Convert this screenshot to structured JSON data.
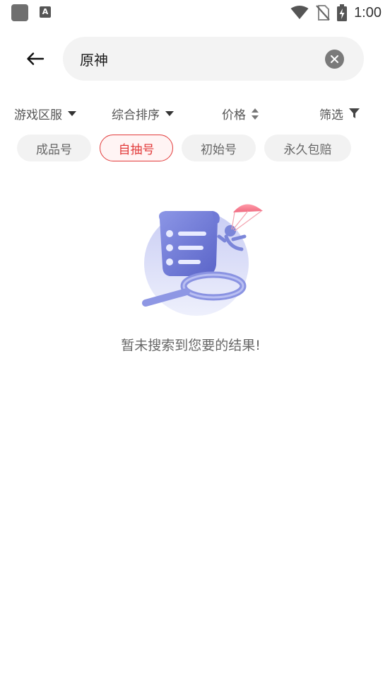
{
  "status_bar": {
    "time": "1:00",
    "left_icons": [
      "app-square-icon",
      "a-text-icon"
    ],
    "right_icons": [
      "wifi-icon",
      "no-sim-icon",
      "battery-charging-icon"
    ]
  },
  "header": {
    "back_icon": "arrow-left-icon",
    "search_value": "原神",
    "clear_icon": "clear-circle-icon"
  },
  "filters": [
    {
      "label": "游戏区服",
      "icon": "caret-down-icon"
    },
    {
      "label": "综合排序",
      "icon": "caret-down-icon"
    },
    {
      "label": "价格",
      "icon": "sort-updown-icon"
    },
    {
      "label": "筛选",
      "icon": "funnel-icon"
    }
  ],
  "chips": [
    {
      "label": "成品号",
      "active": false
    },
    {
      "label": "自抽号",
      "active": true
    },
    {
      "label": "初始号",
      "active": false
    },
    {
      "label": "永久包赔",
      "active": false
    }
  ],
  "empty_state": {
    "message": "暂未搜索到您要的结果!"
  },
  "colors": {
    "accent": "#e23a3a",
    "chip_bg": "#f2f2f2",
    "search_bg": "#f3f3f3",
    "illustration": "#7b86d9"
  }
}
